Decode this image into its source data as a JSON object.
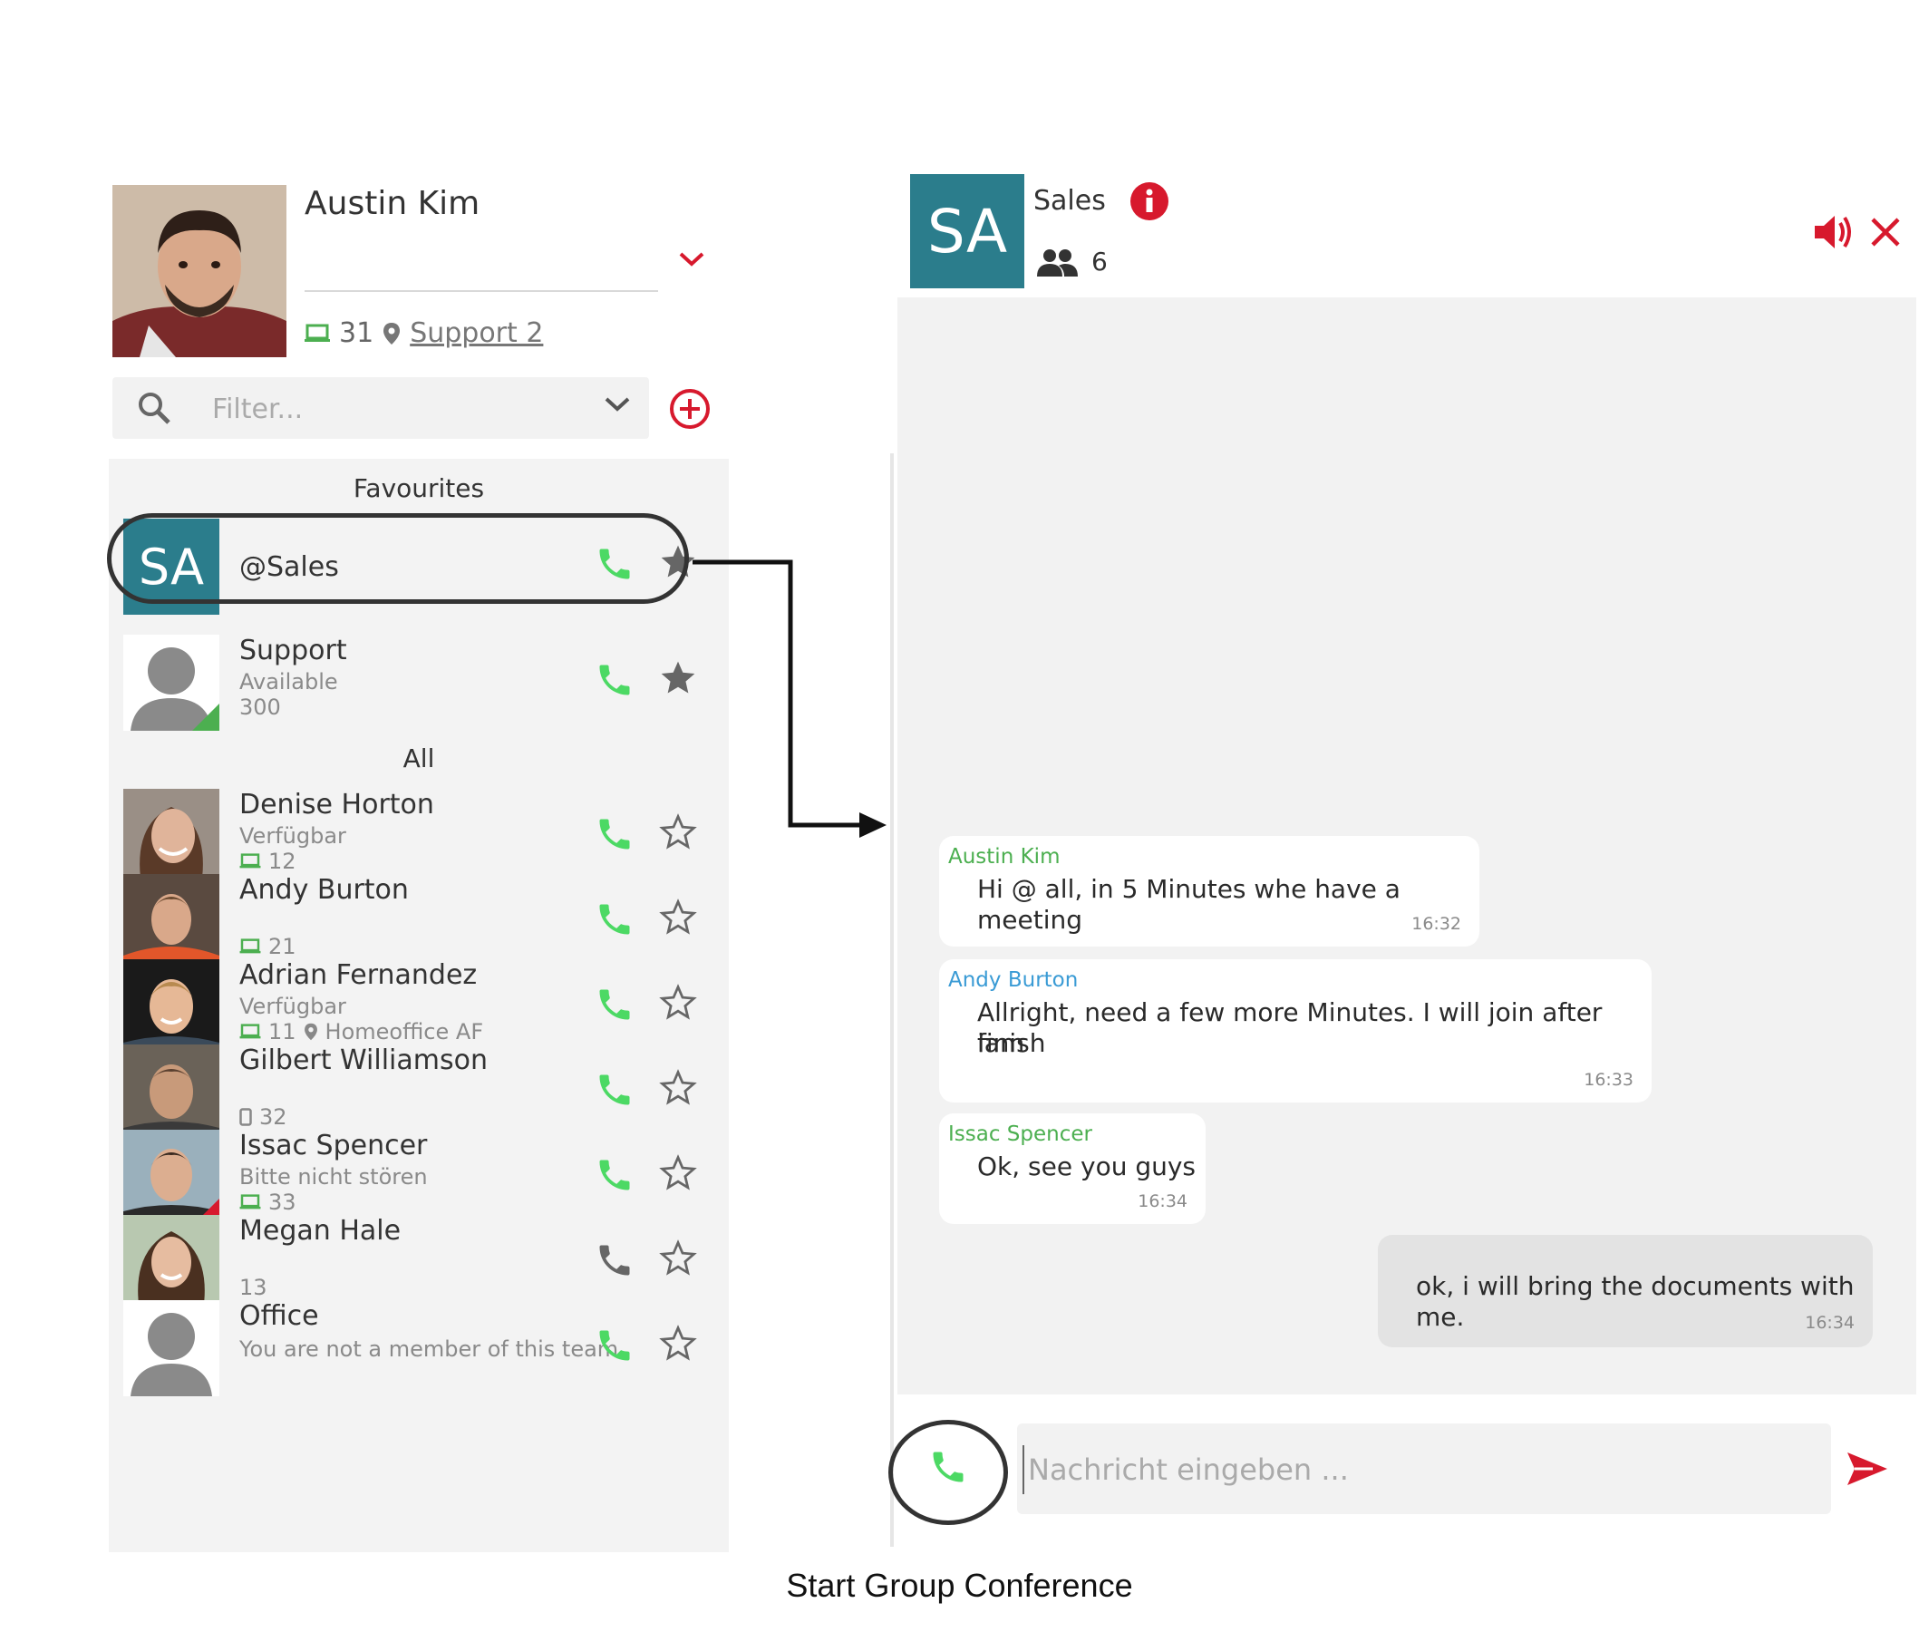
{
  "profile": {
    "name": "Austin Kim",
    "extension": "31",
    "location": "Support 2"
  },
  "filter": {
    "placeholder": "Filter..."
  },
  "sections": {
    "favourites": "Favourites",
    "all": "All"
  },
  "favourites": [
    {
      "name": "@Sales",
      "initials": "SA"
    },
    {
      "name": "Support",
      "status": "Available",
      "extension": "300",
      "status_color": "#4caf50"
    }
  ],
  "contacts": [
    {
      "name": "Denise Horton",
      "status": "Verfügbar",
      "extension": "12",
      "device": "desktop-icon"
    },
    {
      "name": "Andy Burton",
      "status": "",
      "extension": "21",
      "device": "desktop-icon"
    },
    {
      "name": "Adrian Fernandez",
      "status": "Verfügbar",
      "extension": "11",
      "device": "desktop-icon",
      "location": "Homeoffice AF"
    },
    {
      "name": "Gilbert Williamson",
      "status": "",
      "extension": "32",
      "device": "mobile-icon"
    },
    {
      "name": "Issac Spencer",
      "status": "Bitte nicht stören",
      "extension": "33",
      "device": "desktop-icon",
      "status_color": "#d7192d"
    },
    {
      "name": "Megan Hale",
      "status": "",
      "extension": "13"
    },
    {
      "name": "Office",
      "status": "You are not a member of this team"
    }
  ],
  "chat": {
    "group_initials": "SA",
    "group_name": "Sales",
    "member_count": "6",
    "composer_placeholder": "Nachricht eingeben ...",
    "messages": [
      {
        "sender": "Austin Kim",
        "sender_color": "#4caf50",
        "text": "Hi @ all, in 5 Minutes whe have a meeting",
        "time": "16:32"
      },
      {
        "sender": "Andy Burton",
        "sender_color": "#3a9bd5",
        "text_line1": "Allright, need a few more Minutes. I will join after iam",
        "text_line2": "finish",
        "time": "16:33"
      },
      {
        "sender": "Issac Spencer",
        "sender_color": "#4caf50",
        "text": "Ok, see you guys",
        "time": "16:34"
      },
      {
        "sender": "",
        "text": "ok, i will bring the documents with me.",
        "time": "16:34"
      }
    ]
  },
  "caption": "Start Group Conference",
  "colors": {
    "accent_red": "#d7192d",
    "phone_green": "#4cd964",
    "teal": "#2b7d8c"
  }
}
